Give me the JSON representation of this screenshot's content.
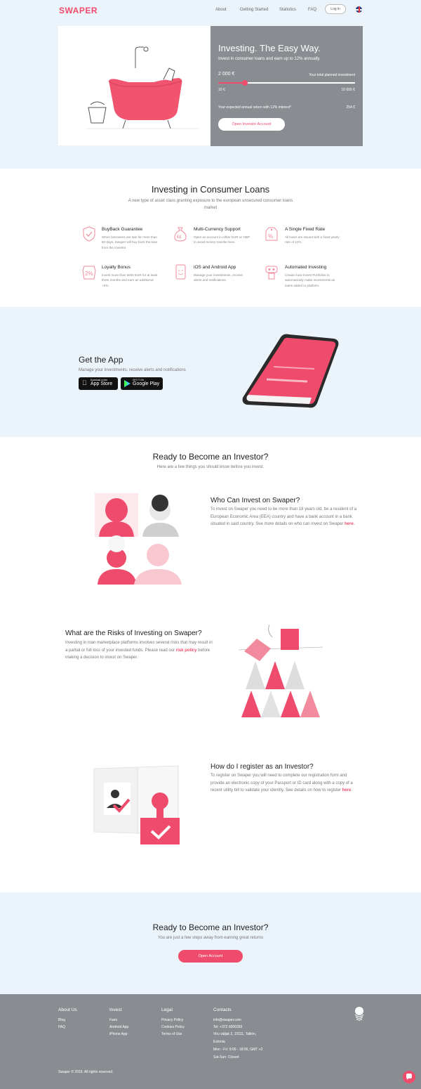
{
  "header": {
    "logo": "SWAPER",
    "nav": [
      "About",
      "Getting Started",
      "Statistics",
      "FAQ"
    ],
    "login": "Log in",
    "language_icon": "uk-flag-icon"
  },
  "hero": {
    "title": "Investing. The Easy Way.",
    "subtitle": "Invest in consumer loans and earn up to 12% annually.",
    "amount": "2 000 €",
    "planned_label": "Your total planned investment",
    "slider_min": "10 €",
    "slider_max": "10 000 €",
    "slider_level": 0.2,
    "return_label": "Your expected annual return with 12% interest*",
    "return_value": "254 €",
    "button": "Open Investor Account"
  },
  "loans": {
    "title": "Investing in Consumer Loans",
    "subtitle": "A new type of asset class granting exposure to the european unsecured consumer loans market",
    "features": [
      {
        "icon": "shield-check-icon",
        "title": "BuyBack Guarantee",
        "desc": "When borrowers are late for more than 60 days, Swaper will buy back the loan from the investor."
      },
      {
        "icon": "currency-bag-icon",
        "title": "Multi-Currency Support",
        "desc": "Open an account in either EUR or GBP to avoid money transfer fees."
      },
      {
        "icon": "percent-tag-icon",
        "title": "A Single Fixed Rate",
        "desc": "All loans are issued with a fixed yearly rate of 12%."
      },
      {
        "icon": "bonus-2-percent-icon",
        "title": "Loyalty Bonus",
        "desc": "Invest more than 5000 EUR for at least three months and earn an additional +2%."
      },
      {
        "icon": "mobile-app-icon",
        "title": "iOS and Android App",
        "desc": "Manage your investments, receive alerts and notifications."
      },
      {
        "icon": "robot-icon",
        "title": "Automated Investing",
        "desc": "Create Auto-Invest Portfolios to automatically make investments as loans added to platform."
      }
    ]
  },
  "app": {
    "title": "Get the App",
    "subtitle": "Manage your investments, receive alerts and notifications",
    "appstore_small": "Download on the",
    "appstore": "App Store",
    "googleplay_small": "GET IT ON",
    "googleplay": "Google Play"
  },
  "investor": {
    "title": "Ready to Become an Investor?",
    "subtitle": "Here are a few things you should know before you invest.",
    "q1_title": "Who Can Invest on Swaper?",
    "q1_body": "To invest on Swaper you need to be more than 18 years old, be a resident of a European Economic Area (EEA) country and have a bank account in a bank situated in said country. See more details on who can invest on Swaper",
    "q1_link": "here",
    "q2_title": "What are the Risks of Investing on Swaper?",
    "q2_body_a": "Investing in loan marketplace platforms involves several risks that may result in a partial or full loss of your invested funds. Please read our",
    "q2_link": "risk policy",
    "q2_body_b": "before making a decision to invest on Swaper.",
    "q3_title": "How do I register as an Investor?",
    "q3_body": "To register on Swaper you will need to complete our registration form and provide an electronic copy of your Passport or ID card along with a copy of a recent utility bill to validate your identity. See details on how to register",
    "q3_link": "here"
  },
  "cta": {
    "title": "Ready to Become an Investor?",
    "subtitle": "You are just a few steps away from earning great returns",
    "button": "Open Account"
  },
  "footer": {
    "about_head": "About Us",
    "about": [
      "Blog",
      "FAQ"
    ],
    "invest_head": "Invest",
    "invest": [
      "Faxo",
      "Android App",
      "iPhone App"
    ],
    "legal_head": "Legal",
    "legal": [
      "Privacy Policy",
      "Cookies Policy",
      "Terms of Use"
    ],
    "contacts_head": "Contacts",
    "contacts": [
      "info@swaper.com",
      "Tel: +372 6000393",
      "Viru väljak 2, 10111, Tallinn,",
      "Estonia",
      "Mon - Fri: 9:00 - 18:00, GMT +2",
      "Sat-Sun: Closed"
    ],
    "copyright": "Swaper © 2015. All rights reserved."
  },
  "colors": {
    "accent": "#ef4b6c",
    "panel": "#898d92",
    "light_bg": "#ecf4fb"
  }
}
